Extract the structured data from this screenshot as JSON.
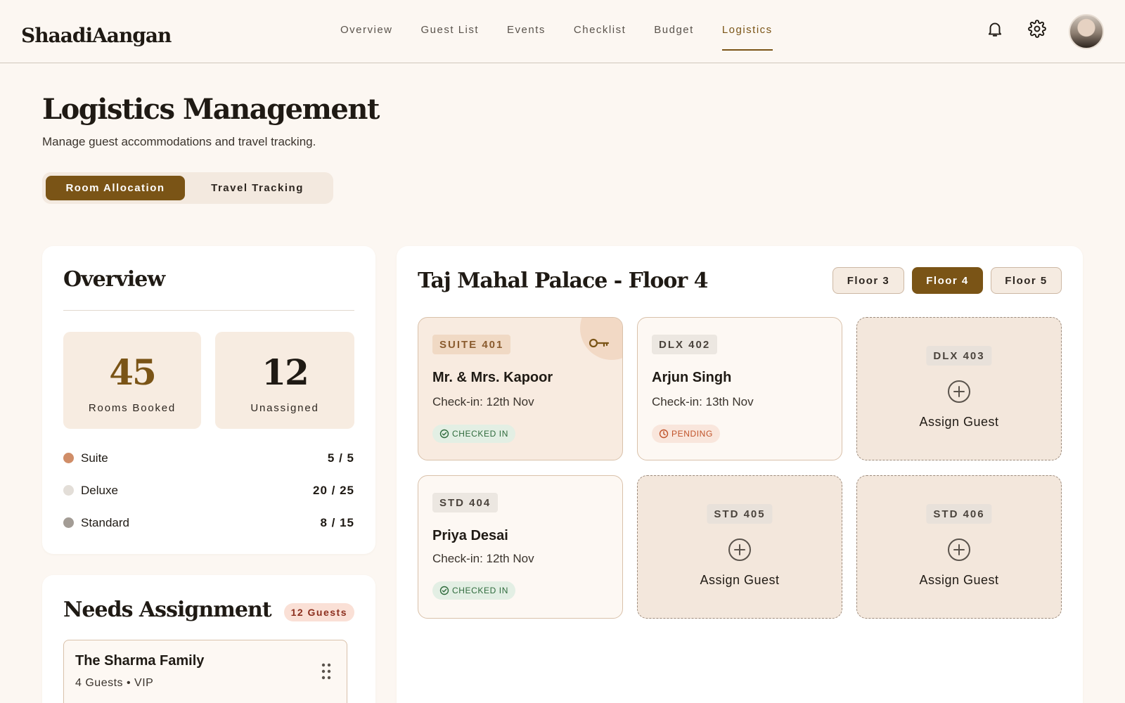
{
  "app": {
    "name": "ShaadiAangan"
  },
  "nav": {
    "items": [
      {
        "label": "Overview"
      },
      {
        "label": "Guest List"
      },
      {
        "label": "Events"
      },
      {
        "label": "Checklist"
      },
      {
        "label": "Budget"
      },
      {
        "label": "Logistics",
        "active": true
      }
    ],
    "icons": [
      "bell-icon",
      "gear-icon"
    ]
  },
  "page": {
    "title": "Logistics Management",
    "subtitle": "Manage guest accommodations and travel tracking.",
    "tabs": [
      {
        "label": "Room Allocation",
        "active": true
      },
      {
        "label": "Travel Tracking",
        "active": false
      }
    ]
  },
  "overview": {
    "title": "Overview",
    "stats": [
      {
        "value": "45",
        "label": "Rooms Booked",
        "color": "#7a5416"
      },
      {
        "value": "12",
        "label": "Unassigned",
        "color": "#1f1a14"
      }
    ],
    "categories": [
      {
        "name": "Suite",
        "value": "5 / 5",
        "color": "#d08d68"
      },
      {
        "name": "Deluxe",
        "value": "20 / 25",
        "color": "#e3ded8"
      },
      {
        "name": "Standard",
        "value": "8 / 15",
        "color": "#a39c95"
      }
    ]
  },
  "needs_assignment": {
    "title": "Needs Assignment",
    "badge": "12 Guests",
    "items": [
      {
        "name": "The Sharma Family",
        "meta": "4 Guests • VIP"
      }
    ]
  },
  "rooms": {
    "title": "Taj Mahal Palace - Floor 4",
    "floors": [
      {
        "label": "Floor 3",
        "active": false
      },
      {
        "label": "Floor 4",
        "active": true
      },
      {
        "label": "Floor 5",
        "active": false
      }
    ],
    "tiles": [
      {
        "tag": "SUITE 401",
        "guest": "Mr. & Mrs. Kapoor",
        "checkin": "Check-in: 12th Nov",
        "status": "CHECKED IN"
      },
      {
        "tag": "DLX 402",
        "guest": "Arjun Singh",
        "checkin": "Check-in: 13th Nov",
        "status": "PENDING"
      },
      {
        "tag": "DLX 403",
        "action": "Assign Guest"
      },
      {
        "tag": "STD 404",
        "guest": "Priya Desai",
        "checkin": "Check-in: 12th Nov",
        "status": "CHECKED IN"
      },
      {
        "tag": "STD 405",
        "action": "Assign Guest"
      },
      {
        "tag": "STD 406",
        "action": "Assign Guest"
      }
    ]
  },
  "colors": {
    "accent": "#7a5416",
    "background": "#fcf7f2",
    "checked_in": "#2f6b3c",
    "pending": "#c0532a"
  }
}
